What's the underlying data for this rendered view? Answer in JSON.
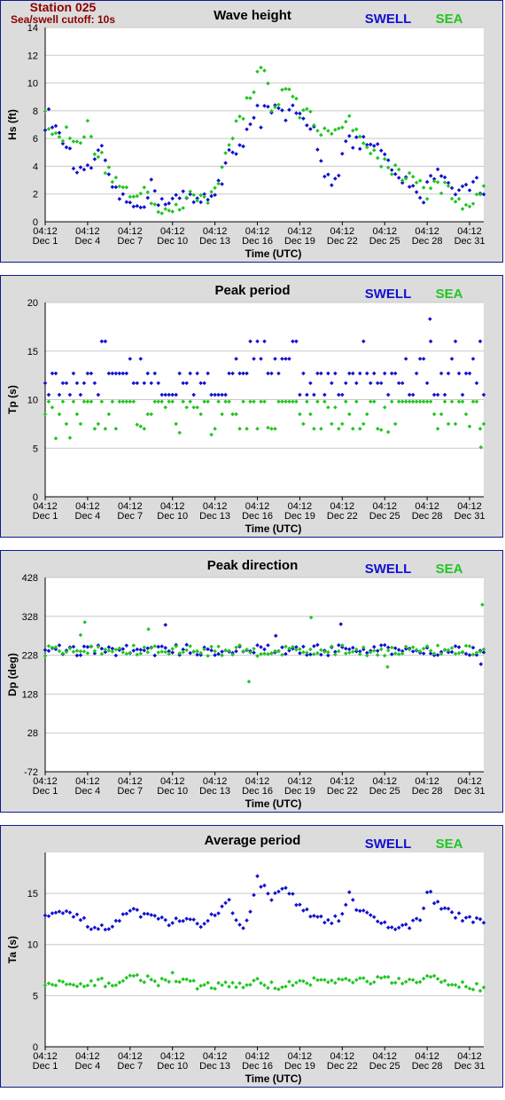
{
  "station_title": "Station 025",
  "cutoff_note": "Sea/swell cutoff: 10s",
  "colors": {
    "swell": "#1010d0",
    "sea": "#22c522",
    "panel_bg": "#dcdcdc",
    "border": "#0b1c8a",
    "station": "#8b0000"
  },
  "x_axis": {
    "title": "Time (UTC)",
    "tick_time": "04:12",
    "tick_dates": [
      "Dec 1",
      "Dec 4",
      "Dec 7",
      "Dec 10",
      "Dec 13",
      "Dec 16",
      "Dec 19",
      "Dec 22",
      "Dec 25",
      "Dec 28",
      "Dec 31"
    ],
    "day_range": [
      1,
      32
    ]
  },
  "chart_data": [
    {
      "type": "scatter",
      "title": "Wave height",
      "ylabel": "Hs (ft)",
      "ylim": [
        0,
        14
      ],
      "yticks": [
        0,
        2,
        4,
        6,
        8,
        10,
        12,
        14
      ],
      "legend": [
        "SWELL",
        "SEA"
      ],
      "legend_position": "top-right",
      "grid": true,
      "anchors": {
        "swell": [
          [
            1,
            7.0
          ],
          [
            1.3,
            7.8
          ],
          [
            2,
            6.0
          ],
          [
            2.5,
            5.6
          ],
          [
            3,
            4.0
          ],
          [
            3.8,
            3.3
          ],
          [
            4.5,
            4.5
          ],
          [
            5,
            5.0
          ],
          [
            5.5,
            3.0
          ],
          [
            6,
            2.3
          ],
          [
            6.5,
            1.5
          ],
          [
            7.2,
            1.2
          ],
          [
            8,
            1.5
          ],
          [
            8.5,
            2.6
          ],
          [
            9,
            1.6
          ],
          [
            10,
            1.6
          ],
          [
            10.5,
            1.8
          ],
          [
            11,
            1.8
          ],
          [
            11.5,
            1.4
          ],
          [
            12.5,
            1.8
          ],
          [
            13,
            2.3
          ],
          [
            13.5,
            3.2
          ],
          [
            14,
            5.0
          ],
          [
            14.5,
            4.6
          ],
          [
            15,
            5.6
          ],
          [
            15.5,
            7.2
          ],
          [
            16,
            8.6
          ],
          [
            16.3,
            7.0
          ],
          [
            16.6,
            8.6
          ],
          [
            17,
            8.2
          ],
          [
            17.5,
            7.8
          ],
          [
            18,
            7.5
          ],
          [
            18.5,
            8.0
          ],
          [
            19,
            7.4
          ],
          [
            20,
            6.5
          ],
          [
            20.8,
            3.5
          ],
          [
            21.3,
            3.0
          ],
          [
            21.8,
            3.8
          ],
          [
            22.3,
            6.0
          ],
          [
            22.8,
            5.5
          ],
          [
            23.4,
            5.8
          ],
          [
            24,
            5.5
          ],
          [
            24.5,
            5.3
          ],
          [
            25,
            4.5
          ],
          [
            25.5,
            3.6
          ],
          [
            26.5,
            2.8
          ],
          [
            27,
            2.2
          ],
          [
            27.8,
            1.8
          ],
          [
            28.3,
            3.5
          ],
          [
            29,
            3.6
          ],
          [
            29.5,
            2.8
          ],
          [
            30.3,
            2.2
          ],
          [
            31,
            2.6
          ],
          [
            31.5,
            2.8
          ],
          [
            32,
            2.1
          ]
        ],
        "sea": [
          [
            1,
            7.6
          ],
          [
            1.5,
            6.8
          ],
          [
            2,
            5.8
          ],
          [
            2.5,
            6.5
          ],
          [
            3,
            6.3
          ],
          [
            3.5,
            6.0
          ],
          [
            4,
            6.8
          ],
          [
            4.5,
            5.2
          ],
          [
            5,
            4.5
          ],
          [
            5.5,
            3.5
          ],
          [
            6,
            3.1
          ],
          [
            6.5,
            2.7
          ],
          [
            7,
            1.8
          ],
          [
            7.5,
            1.6
          ],
          [
            8,
            2.4
          ],
          [
            8.5,
            1.5
          ],
          [
            9,
            1.1
          ],
          [
            9.5,
            1.0
          ],
          [
            10,
            1.2
          ],
          [
            10.5,
            1.1
          ],
          [
            11,
            1.6
          ],
          [
            11.5,
            1.7
          ],
          [
            12,
            2.0
          ],
          [
            12.5,
            1.5
          ],
          [
            13,
            2.5
          ],
          [
            13.5,
            4.0
          ],
          [
            14,
            6.0
          ],
          [
            14.5,
            7.0
          ],
          [
            15,
            7.8
          ],
          [
            15.5,
            9.0
          ],
          [
            16,
            10.5
          ],
          [
            16.3,
            11.3
          ],
          [
            16.7,
            10.0
          ],
          [
            17,
            8.5
          ],
          [
            17.3,
            8.0
          ],
          [
            17.7,
            9.5
          ],
          [
            18,
            9.8
          ],
          [
            18.5,
            9.0
          ],
          [
            19,
            7.8
          ],
          [
            19.5,
            7.9
          ],
          [
            20,
            7.5
          ],
          [
            20.5,
            6.0
          ],
          [
            21,
            6.5
          ],
          [
            21.5,
            7.0
          ],
          [
            22,
            7.0
          ],
          [
            22.5,
            7.8
          ],
          [
            23,
            6.2
          ],
          [
            23.5,
            5.5
          ],
          [
            24,
            5.2
          ],
          [
            24.5,
            4.8
          ],
          [
            25,
            4.2
          ],
          [
            25.5,
            3.8
          ],
          [
            26,
            3.5
          ],
          [
            26.5,
            3.0
          ],
          [
            27,
            3.6
          ],
          [
            27.5,
            2.7
          ],
          [
            28,
            2.0
          ],
          [
            28.5,
            2.4
          ],
          [
            29,
            2.6
          ],
          [
            29.5,
            2.2
          ],
          [
            30,
            1.6
          ],
          [
            30.5,
            1.3
          ],
          [
            31,
            1.2
          ],
          [
            31.5,
            2.3
          ],
          [
            32,
            2.2
          ]
        ],
        "swell_noise": 0.5,
        "sea_noise": 0.55
      }
    },
    {
      "type": "scatter",
      "title": "Peak period",
      "ylabel": "Tp (s)",
      "ylim": [
        0,
        20
      ],
      "yticks": [
        0,
        5,
        10,
        15,
        20
      ],
      "legend": [
        "SWELL",
        "SEA"
      ],
      "legend_position": "top-right",
      "grid": true,
      "levels": {
        "swell": [
          10.5,
          11.7,
          12.7,
          14.2,
          16.0
        ],
        "sea": [
          8.5,
          9.8,
          9.8,
          9.8,
          9.2,
          7.5,
          7.0
        ]
      },
      "highlights": {
        "swell_max": 18.3,
        "sea_min": 5.1
      }
    },
    {
      "type": "scatter",
      "title": "Peak direction",
      "ylabel": "Dp (deg)",
      "ylim": [
        -72,
        428
      ],
      "yticks": [
        -72,
        28,
        128,
        228,
        328,
        428
      ],
      "legend": [
        "SWELL",
        "SEA"
      ],
      "legend_position": "top-right",
      "grid": true,
      "typical": {
        "swell": 241,
        "sea": 240,
        "spread": 14
      },
      "outliers": [
        {
          "series": "sea",
          "x": 3.8,
          "y": 313
        },
        {
          "series": "sea",
          "x": 3.5,
          "y": 280
        },
        {
          "series": "swell",
          "x": 9.5,
          "y": 306
        },
        {
          "series": "sea",
          "x": 8.3,
          "y": 295
        },
        {
          "series": "sea",
          "x": 15.4,
          "y": 160
        },
        {
          "series": "swell",
          "x": 17.3,
          "y": 278
        },
        {
          "series": "sea",
          "x": 19.8,
          "y": 325
        },
        {
          "series": "swell",
          "x": 21.9,
          "y": 308
        },
        {
          "series": "sea",
          "x": 25.2,
          "y": 198
        },
        {
          "series": "swell",
          "x": 31.8,
          "y": 205
        },
        {
          "series": "sea",
          "x": 31.9,
          "y": 358
        }
      ]
    },
    {
      "type": "scatter",
      "title": "Average period",
      "ylabel": "Ta (s)",
      "ylim": [
        0,
        19
      ],
      "yticks": [
        0,
        5,
        10,
        15
      ],
      "legend": [
        "SWELL",
        "SEA"
      ],
      "legend_position": "top-right",
      "grid": true,
      "anchors": {
        "swell": [
          [
            1,
            13.2
          ],
          [
            2,
            13.1
          ],
          [
            3,
            12.8
          ],
          [
            4,
            12.0
          ],
          [
            5,
            11.5
          ],
          [
            6,
            12.0
          ],
          [
            7,
            13.3
          ],
          [
            8,
            12.7
          ],
          [
            9,
            12.4
          ],
          [
            10,
            12.2
          ],
          [
            11,
            12.2
          ],
          [
            12,
            12.0
          ],
          [
            13,
            13.2
          ],
          [
            14,
            14.0
          ],
          [
            14.6,
            12.5
          ],
          [
            15,
            12.0
          ],
          [
            15.6,
            13.5
          ],
          [
            16,
            16.3
          ],
          [
            16.5,
            15.5
          ],
          [
            17,
            14.5
          ],
          [
            18,
            15.4
          ],
          [
            19,
            13.8
          ],
          [
            20,
            12.5
          ],
          [
            21,
            12.4
          ],
          [
            22,
            12.6
          ],
          [
            22.5,
            14.9
          ],
          [
            23,
            13.5
          ],
          [
            24,
            12.6
          ],
          [
            25,
            11.9
          ],
          [
            26,
            11.8
          ],
          [
            27,
            12.0
          ],
          [
            27.5,
            12.5
          ],
          [
            28,
            15.3
          ],
          [
            28.5,
            14.4
          ],
          [
            29,
            13.5
          ],
          [
            30,
            12.8
          ],
          [
            31,
            12.4
          ],
          [
            32,
            12.0
          ]
        ],
        "sea": [
          [
            1,
            6.0
          ],
          [
            2,
            6.1
          ],
          [
            3,
            5.9
          ],
          [
            4,
            6.0
          ],
          [
            5,
            6.3
          ],
          [
            6,
            6.2
          ],
          [
            7,
            6.8
          ],
          [
            8,
            6.7
          ],
          [
            9,
            6.3
          ],
          [
            10,
            6.9
          ],
          [
            11,
            6.2
          ],
          [
            12,
            6.0
          ],
          [
            13,
            5.9
          ],
          [
            14,
            6.1
          ],
          [
            15,
            6.0
          ],
          [
            16,
            6.3
          ],
          [
            17,
            6.0
          ],
          [
            18,
            6.0
          ],
          [
            19,
            6.2
          ],
          [
            20,
            6.5
          ],
          [
            21,
            6.4
          ],
          [
            22,
            6.5
          ],
          [
            23,
            6.4
          ],
          [
            24,
            6.5
          ],
          [
            25,
            6.6
          ],
          [
            26,
            6.3
          ],
          [
            27,
            6.2
          ],
          [
            28,
            6.8
          ],
          [
            29,
            6.5
          ],
          [
            30,
            6.0
          ],
          [
            31,
            6.0
          ],
          [
            32,
            5.8
          ]
        ],
        "swell_noise": 0.4,
        "sea_noise": 0.4
      }
    }
  ]
}
